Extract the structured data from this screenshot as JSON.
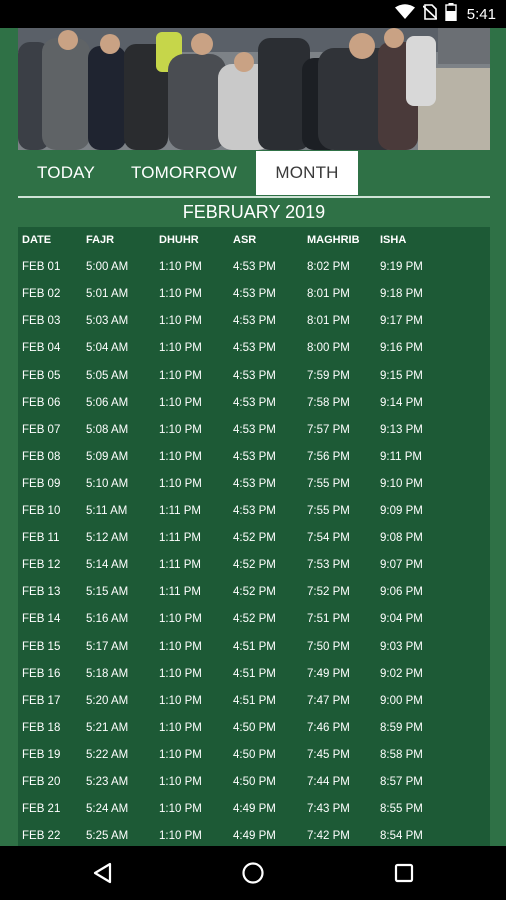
{
  "status_bar": {
    "time": "5:41",
    "icons": [
      "wifi-icon",
      "no-sim-icon",
      "battery-icon"
    ]
  },
  "hero": {
    "image": "crowd-of-worshippers-photo"
  },
  "tabs": [
    {
      "label": "TODAY"
    },
    {
      "label": "TOMORROW"
    },
    {
      "label": "MONTH",
      "active": true
    }
  ],
  "month_title": "FEBRUARY 2019",
  "table": {
    "headers": [
      "DATE",
      "FAJR",
      "DHUHR",
      "ASR",
      "MAGHRIB",
      "ISHA"
    ],
    "rows": [
      [
        "FEB 01",
        "5:00 AM",
        "1:10 PM",
        "4:53 PM",
        "8:02 PM",
        "9:19 PM"
      ],
      [
        "FEB 02",
        "5:01 AM",
        "1:10 PM",
        "4:53 PM",
        "8:01 PM",
        "9:18 PM"
      ],
      [
        "FEB 03",
        "5:03 AM",
        "1:10 PM",
        "4:53 PM",
        "8:01 PM",
        "9:17 PM"
      ],
      [
        "FEB 04",
        "5:04 AM",
        "1:10 PM",
        "4:53 PM",
        "8:00 PM",
        "9:16 PM"
      ],
      [
        "FEB 05",
        "5:05 AM",
        "1:10 PM",
        "4:53 PM",
        "7:59 PM",
        "9:15 PM"
      ],
      [
        "FEB 06",
        "5:06 AM",
        "1:10 PM",
        "4:53 PM",
        "7:58 PM",
        "9:14 PM"
      ],
      [
        "FEB 07",
        "5:08 AM",
        "1:10 PM",
        "4:53 PM",
        "7:57 PM",
        "9:13 PM"
      ],
      [
        "FEB 08",
        "5:09 AM",
        "1:10 PM",
        "4:53 PM",
        "7:56 PM",
        "9:11 PM"
      ],
      [
        "FEB 09",
        "5:10 AM",
        "1:10 PM",
        "4:53 PM",
        "7:55 PM",
        "9:10 PM"
      ],
      [
        "FEB 10",
        "5:11 AM",
        "1:11 PM",
        "4:53 PM",
        "7:55 PM",
        "9:09 PM"
      ],
      [
        "FEB 11",
        "5:12 AM",
        "1:11 PM",
        "4:52 PM",
        "7:54 PM",
        "9:08 PM"
      ],
      [
        "FEB 12",
        "5:14 AM",
        "1:11 PM",
        "4:52 PM",
        "7:53 PM",
        "9:07 PM"
      ],
      [
        "FEB 13",
        "5:15 AM",
        "1:11 PM",
        "4:52 PM",
        "7:52 PM",
        "9:06 PM"
      ],
      [
        "FEB 14",
        "5:16 AM",
        "1:10 PM",
        "4:52 PM",
        "7:51 PM",
        "9:04 PM"
      ],
      [
        "FEB 15",
        "5:17 AM",
        "1:10 PM",
        "4:51 PM",
        "7:50 PM",
        "9:03 PM"
      ],
      [
        "FEB 16",
        "5:18 AM",
        "1:10 PM",
        "4:51 PM",
        "7:49 PM",
        "9:02 PM"
      ],
      [
        "FEB 17",
        "5:20 AM",
        "1:10 PM",
        "4:51 PM",
        "7:47 PM",
        "9:00 PM"
      ],
      [
        "FEB 18",
        "5:21 AM",
        "1:10 PM",
        "4:50 PM",
        "7:46 PM",
        "8:59 PM"
      ],
      [
        "FEB 19",
        "5:22 AM",
        "1:10 PM",
        "4:50 PM",
        "7:45 PM",
        "8:58 PM"
      ],
      [
        "FEB 20",
        "5:23 AM",
        "1:10 PM",
        "4:50 PM",
        "7:44 PM",
        "8:57 PM"
      ],
      [
        "FEB 21",
        "5:24 AM",
        "1:10 PM",
        "4:49 PM",
        "7:43 PM",
        "8:55 PM"
      ],
      [
        "FEB 22",
        "5:25 AM",
        "1:10 PM",
        "4:49 PM",
        "7:42 PM",
        "8:54 PM"
      ]
    ]
  },
  "nav_bar": {
    "buttons": [
      "back-icon",
      "home-icon",
      "recents-icon"
    ]
  },
  "colors": {
    "background": "#2f7146",
    "table_panel": "#1d5a36",
    "tab_active": "#ffffff",
    "status_bar": "#000000"
  }
}
